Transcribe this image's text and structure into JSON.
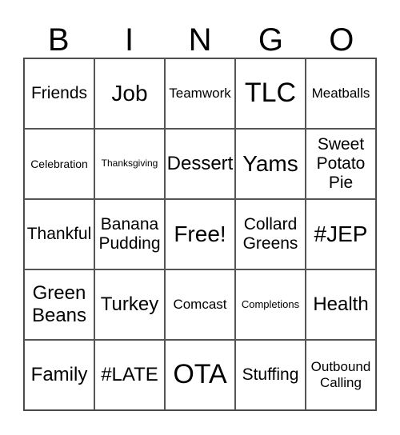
{
  "header": {
    "letters": [
      "B",
      "I",
      "N",
      "G",
      "O"
    ]
  },
  "cells": [
    [
      "Friends",
      "Job",
      "Teamwork",
      "TLC",
      "Meatballs"
    ],
    [
      "Celebration",
      "Thanksgiving",
      "Dessert",
      "Yams",
      "Sweet Potato Pie"
    ],
    [
      "Thankful",
      "Banana Pudding",
      "Free!",
      "Collard Greens",
      "#JEP"
    ],
    [
      "Green Beans",
      "Turkey",
      "Comcast",
      "Completions",
      "Health"
    ],
    [
      "Family",
      "#LATE",
      "OTA",
      "Stuffing",
      "Outbound Calling"
    ]
  ]
}
